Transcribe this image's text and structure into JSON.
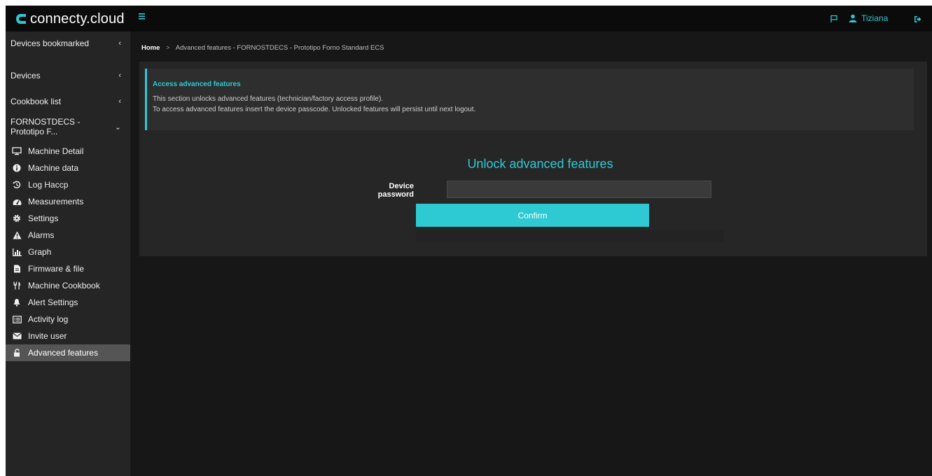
{
  "app": {
    "brand": "connecty.cloud",
    "accent_color": "#2fc9d4",
    "user_name": "Tiziana"
  },
  "sidebar": {
    "sections": [
      {
        "label": "Devices bookmarked",
        "chevron": "‹"
      },
      {
        "label": "Devices",
        "chevron": "‹"
      },
      {
        "label": "Cookbook list",
        "chevron": "‹"
      },
      {
        "label": "FORNOSTDECS - Prototipo F...",
        "chevron": "⌄"
      }
    ],
    "items": [
      {
        "label": "Machine Detail",
        "icon": "monitor-icon"
      },
      {
        "label": "Machine data",
        "icon": "info-circle-icon"
      },
      {
        "label": "Log Haccp",
        "icon": "history-icon"
      },
      {
        "label": "Measurements",
        "icon": "dashboard-icon"
      },
      {
        "label": "Settings",
        "icon": "gear-icon"
      },
      {
        "label": "Alarms",
        "icon": "warning-icon"
      },
      {
        "label": "Graph",
        "icon": "bar-chart-icon"
      },
      {
        "label": "Firmware & file",
        "icon": "file-icon"
      },
      {
        "label": "Machine Cookbook",
        "icon": "cutlery-icon"
      },
      {
        "label": "Alert Settings",
        "icon": "bell-icon"
      },
      {
        "label": "Activity log",
        "icon": "list-icon"
      },
      {
        "label": "Invite user",
        "icon": "envelope-icon"
      },
      {
        "label": "Advanced features",
        "icon": "unlock-icon",
        "active": true
      }
    ]
  },
  "breadcrumb": {
    "home": "Home",
    "separator": ">",
    "current": "Advanced features - FORNOSTDECS - Prototipo Forno Standard ECS"
  },
  "info": {
    "title": "Access advanced features",
    "line1": "This section unlocks advanced features (technician/factory access profile).",
    "line2": "To access advanced features insert the device passcode. Unlocked features will persist until next logout."
  },
  "unlock": {
    "title": "Unlock advanced features",
    "password_label": "Device password",
    "password_value": "",
    "confirm_label": "Confirm"
  }
}
